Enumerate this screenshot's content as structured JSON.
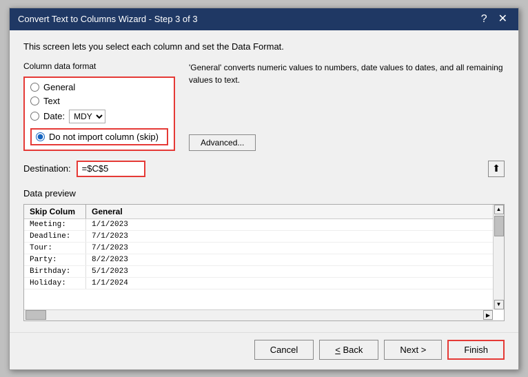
{
  "dialog": {
    "title": "Convert Text to Columns Wizard - Step 3 of 3",
    "help_btn": "?",
    "close_btn": "✕"
  },
  "description": "This screen lets you select each column and set the Data Format.",
  "column_format": {
    "label": "Column data format",
    "options": [
      {
        "id": "general",
        "label": "General",
        "checked": false
      },
      {
        "id": "text",
        "label": "Text",
        "checked": false
      },
      {
        "id": "date",
        "label": "Date:",
        "checked": false
      },
      {
        "id": "skip",
        "label": "Do not import column (skip)",
        "checked": true
      }
    ],
    "date_value": "MDY"
  },
  "info_text": "'General' converts numeric values to numbers, date values to dates, and all remaining values to text.",
  "advanced_btn": "Advanced...",
  "destination": {
    "label": "Destination:",
    "value": "=$C$5"
  },
  "data_preview": {
    "label": "Data preview",
    "columns": [
      {
        "header": "Skip Colum",
        "type": "skip"
      },
      {
        "header": "General",
        "type": "general"
      }
    ],
    "rows": [
      {
        "col1": "Meeting:",
        "col2": "1/1/2023"
      },
      {
        "col1": "Deadline:",
        "col2": "7/1/2023"
      },
      {
        "col1": "Tour:",
        "col2": "7/1/2023"
      },
      {
        "col1": "Party:",
        "col2": "8/2/2023"
      },
      {
        "col1": "Birthday:",
        "col2": "5/1/2023"
      },
      {
        "col1": "Holiday:",
        "col2": "1/1/2024"
      }
    ]
  },
  "footer": {
    "cancel_label": "Cancel",
    "back_label": "< Back",
    "next_label": "Next >",
    "finish_label": "Finish"
  }
}
